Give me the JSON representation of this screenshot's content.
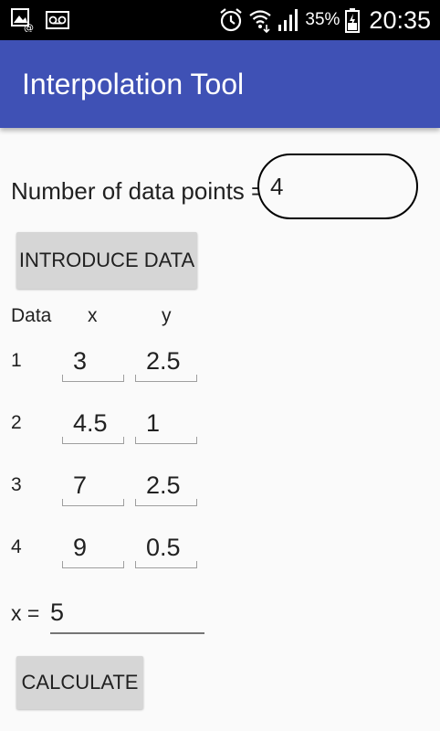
{
  "status_bar": {
    "left_icons": [
      "screenshot-notification-icon",
      "voicemail-icon"
    ],
    "right_icons": [
      "alarm-icon",
      "wifi-icon",
      "signal-icon",
      "battery-icon"
    ],
    "battery_percent": "35%",
    "time": "20:35"
  },
  "app_bar": {
    "title": "Interpolation Tool",
    "color": "#3f51b5"
  },
  "form": {
    "count_label": "Number of data points =",
    "count_value": "4",
    "introduce_button": "INTRODUCE DATA",
    "headers": {
      "data": "Data",
      "x": "x",
      "y": "y"
    },
    "rows": [
      {
        "index": "1",
        "x": "3",
        "y": "2.5"
      },
      {
        "index": "2",
        "x": "4.5",
        "y": "1"
      },
      {
        "index": "3",
        "x": "7",
        "y": "2.5"
      },
      {
        "index": "4",
        "x": "9",
        "y": "0.5"
      }
    ],
    "x_eval_label": "x =",
    "x_eval_value": "5",
    "calculate_button": "CALCULATE"
  }
}
